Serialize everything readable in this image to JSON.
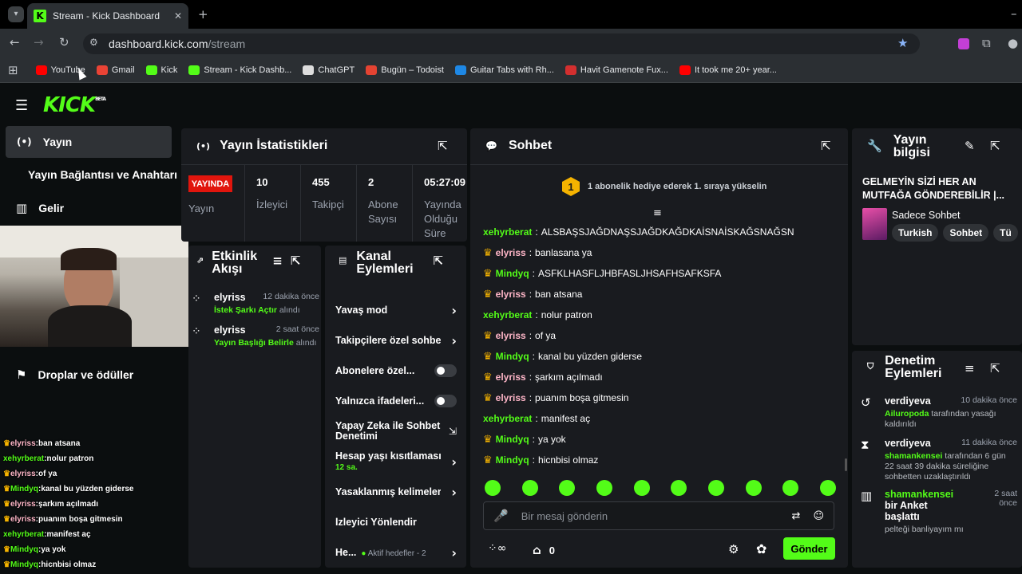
{
  "browser": {
    "tab_title": "Stream - Kick Dashboard",
    "url_host": "dashboard.kick.com",
    "url_path": "/stream",
    "bookmarks": [
      {
        "label": "YouTube",
        "color": "#ff0000"
      },
      {
        "label": "Gmail",
        "color": "#ea4335"
      },
      {
        "label": "Kick",
        "color": "#53fc18"
      },
      {
        "label": "Stream - Kick Dashb...",
        "color": "#53fc18"
      },
      {
        "label": "ChatGPT",
        "color": "#dddddd"
      },
      {
        "label": "Bugün – Todoist",
        "color": "#e44332"
      },
      {
        "label": "Guitar Tabs with Rh...",
        "color": "#1e88e5"
      },
      {
        "label": "Havit Gamenote Fux...",
        "color": "#d32f2f"
      },
      {
        "label": "It took me 20+ year...",
        "color": "#ff0000"
      }
    ]
  },
  "app": {
    "logo": "KICK",
    "beta": "BETA"
  },
  "sidebar": {
    "items": [
      "Yayın",
      "Yayın Bağlantısı ve Anahtarı",
      "Gelir",
      "Droplar ve ödüller"
    ]
  },
  "overlay_chat": [
    {
      "user": "elyriss",
      "msg": "ban atsana",
      "crown": true,
      "color": "#ffb6c8"
    },
    {
      "user": "xehyrberat",
      "msg": "nolur patron",
      "crown": false,
      "color": "#53fc18"
    },
    {
      "user": "elyriss",
      "msg": "of ya",
      "crown": true,
      "color": "#ffb6c8"
    },
    {
      "user": "Mindyq",
      "msg": "kanal bu yüzden giderse",
      "crown": true,
      "color": "#53fc18"
    },
    {
      "user": "elyriss",
      "msg": "şarkım açılmadı",
      "crown": true,
      "color": "#ffb6c8"
    },
    {
      "user": "elyriss",
      "msg": "puanım boşa gitmesin",
      "crown": true,
      "color": "#ffb6c8"
    },
    {
      "user": "xehyrberat",
      "msg": "manifest aç",
      "crown": false,
      "color": "#53fc18"
    },
    {
      "user": "Mindyq",
      "msg": "ya yok",
      "crown": true,
      "color": "#53fc18"
    },
    {
      "user": "Mindyq",
      "msg": "hicnbisi olmaz",
      "crown": true,
      "color": "#53fc18"
    }
  ],
  "stats": {
    "title": "Yayın İstatistikleri",
    "live_badge": "YAYINDA",
    "live_label": "Yayın",
    "cols": [
      {
        "value": "10",
        "label": "İzleyici"
      },
      {
        "value": "455",
        "label": "Takipçi"
      },
      {
        "value": "2",
        "label": "Abone Sayısı"
      },
      {
        "value": "05:27:09",
        "label": "Yayında Olduğu Süre"
      }
    ]
  },
  "activity": {
    "title": "Etkinlik Akışı",
    "items": [
      {
        "user": "elyriss",
        "time": "12 dakika önce",
        "action": "İstek Şarkı Açtır",
        "suffix": "alındı"
      },
      {
        "user": "elyriss",
        "time": "2 saat önce",
        "action": "Yayın Başlığı Belirle",
        "suffix": "alındı"
      }
    ]
  },
  "channel": {
    "title": "Kanal Eylemleri",
    "items": [
      {
        "label": "Yavaş mod",
        "ctl": "arrow"
      },
      {
        "label": "Takipçilere özel sohbe",
        "ctl": "arrow"
      },
      {
        "label": "Abonelere özel...",
        "ctl": "toggle"
      },
      {
        "label": "Yalnızca ifadeleri...",
        "ctl": "toggle"
      },
      {
        "label": "Yapay Zeka ile Sohbet Denetimi",
        "ctl": "ext"
      },
      {
        "label": "Hesap yaşı kısıtlaması",
        "sub": "12 sa.",
        "ctl": "arrow"
      },
      {
        "label": "Yasaklanmış kelimeler",
        "ctl": "arrow"
      },
      {
        "label": "İzleyici Yönlendir",
        "ctl": "none"
      },
      {
        "label": "He...",
        "sub2": "Aktif hedefler - 2",
        "ctl": "arrow"
      }
    ]
  },
  "chat": {
    "title": "Sohbet",
    "rank": "1",
    "promo": "1 abonelik hediye ederek 1. sıraya yükselin",
    "input_placeholder": "Bir mesaj gönderin",
    "send": "Gönder",
    "points": "0",
    "messages": [
      {
        "user": "xehyrberat",
        "msg": "ALSBAŞSJAĞDNAŞSJAĞDKAĞDKAİSNAİSKAĞSNAĞSN",
        "crown": false,
        "color": "#53fc18"
      },
      {
        "user": "elyriss",
        "msg": "banlasana ya",
        "crown": true,
        "color": "#ffb6c8"
      },
      {
        "user": "Mindyq",
        "msg": "ASFKLHASFLJHBFASLJHSAFHSAFKSFA",
        "crown": true,
        "color": "#53fc18"
      },
      {
        "user": "elyriss",
        "msg": "ban atsana",
        "crown": true,
        "color": "#ffb6c8"
      },
      {
        "user": "xehyrberat",
        "msg": "nolur patron",
        "crown": false,
        "color": "#53fc18"
      },
      {
        "user": "elyriss",
        "msg": "of ya",
        "crown": true,
        "color": "#ffb6c8"
      },
      {
        "user": "Mindyq",
        "msg": "kanal bu yüzden giderse",
        "crown": true,
        "color": "#53fc18"
      },
      {
        "user": "elyriss",
        "msg": "şarkım açılmadı",
        "crown": true,
        "color": "#ffb6c8"
      },
      {
        "user": "elyriss",
        "msg": "puanım boşa gitmesin",
        "crown": true,
        "color": "#ffb6c8"
      },
      {
        "user": "xehyrberat",
        "msg": "manifest aç",
        "crown": false,
        "color": "#53fc18"
      },
      {
        "user": "Mindyq",
        "msg": "ya yok",
        "crown": true,
        "color": "#53fc18"
      },
      {
        "user": "Mindyq",
        "msg": "hicnbisi olmaz",
        "crown": true,
        "color": "#53fc18"
      }
    ]
  },
  "info": {
    "title": "Yayın bilgisi",
    "stream_title": "GELMEYİN SİZİ HER AN MUTFAĞA GÖNDEREBİLİR |...",
    "category": "Sadece Sohbet",
    "tags": [
      "Turkish",
      "Sohbet",
      "Tü"
    ]
  },
  "mod": {
    "title": "Denetim Eylemleri",
    "items": [
      {
        "user": "verdiyeva",
        "time": "10 dakika önce",
        "actor": "Ailuropoda",
        "text": "tarafından yasağı kaldırıldı"
      },
      {
        "user": "verdiyeva",
        "time": "11 dakika önce",
        "actor": "shamankensei",
        "text": "tarafından 6 gün 22 saat 39 dakika süreliğine sohbetten uzaklaştırıldı"
      },
      {
        "user": "shamankensei",
        "user_suffix": "bir Anket başlattı",
        "time": "2 saat önce",
        "text": "pelteği banliyayım mı"
      }
    ]
  }
}
